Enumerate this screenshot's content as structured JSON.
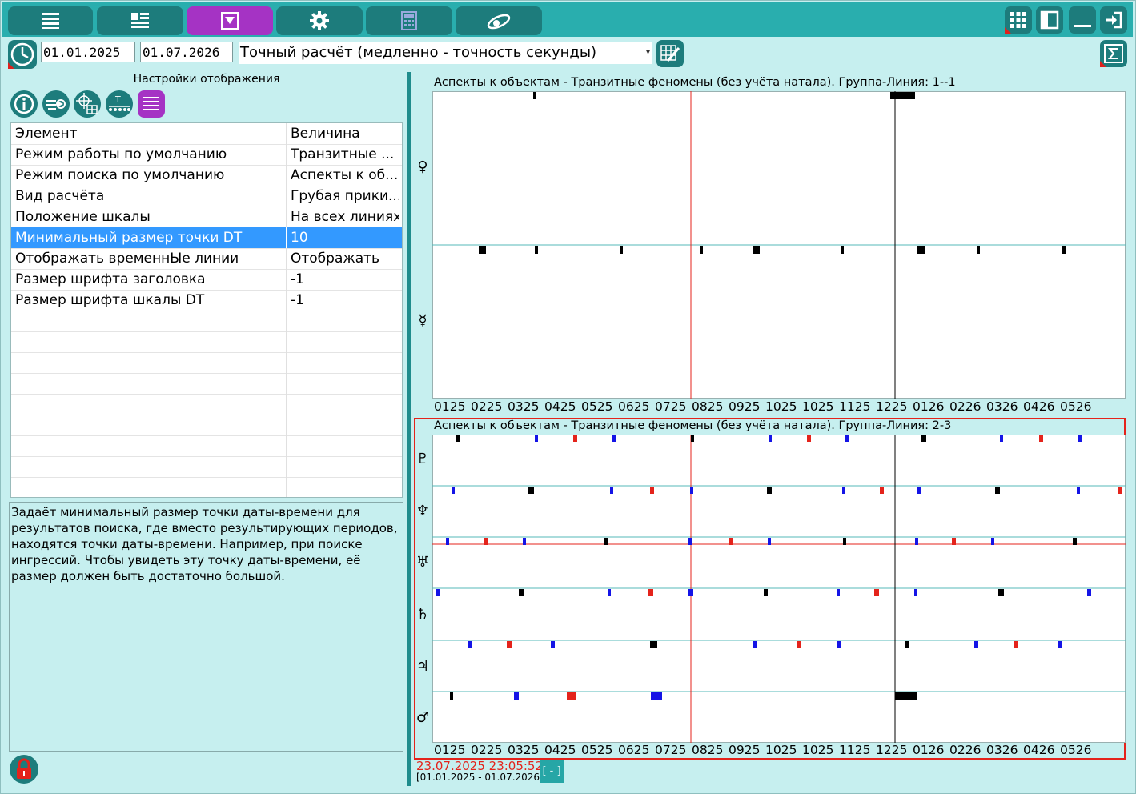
{
  "toolbar": {
    "buttons": [
      {
        "icon": "list-icon"
      },
      {
        "icon": "layout-icon"
      },
      {
        "icon": "filter-icon",
        "active": true
      },
      {
        "icon": "gear-icon"
      },
      {
        "icon": "calculator-icon"
      },
      {
        "icon": "orbit-icon"
      }
    ],
    "right_buttons": [
      {
        "icon": "grid-icon"
      },
      {
        "icon": "panel-icon"
      },
      {
        "icon": "minimize-icon"
      },
      {
        "icon": "exit-icon"
      }
    ]
  },
  "range": {
    "start_date": "01.01.2025",
    "end_date": "01.07.2026",
    "calc_mode": "Точный расчёт (медленно - точность секунды)"
  },
  "left_panel": {
    "title": "Настройки отображения",
    "tool_icons": [
      "info-icon",
      "transfer-icon",
      "crosshair-grid-icon",
      "timeline-icon",
      "dots-grid-icon"
    ],
    "grid": {
      "headers": [
        "Элемент",
        "Величина"
      ],
      "rows": [
        {
          "name": "Режим работы по умолчанию",
          "value": "Транзитные ..."
        },
        {
          "name": "Режим поиска по умолчанию",
          "value": "Аспекты к об..."
        },
        {
          "name": "Вид расчёта",
          "value": "Грубая прики..."
        },
        {
          "name": "Положение шкалы",
          "value": "На всех линиях"
        },
        {
          "name": "Минимальный размер точки DT",
          "value": "10"
        },
        {
          "name": "Отображать временнЫе линии",
          "value": "Отображать"
        },
        {
          "name": "Размер шрифта заголовка",
          "value": "-1"
        },
        {
          "name": "Размер шрифта шкалы DT",
          "value": "-1"
        }
      ],
      "selected_index": 4
    },
    "description": "Задаёт минимальный размер точки даты-времени для результатов поиска, где вместо результирующих периодов, находятся точки даты-времени. Например, при поиске ингрессий. Чтобы увидеть эту точку даты-времени, её размер должен быть достаточно большой."
  },
  "colors": {
    "accent": "#29aeae",
    "button": "#1d7c7c",
    "active": "#a533c4",
    "selection": "#3399ff",
    "marker_red": "#e4231b",
    "marker_blue": "#1414e6",
    "marker_black": "#000000"
  },
  "charts": [
    {
      "title": "Аспекты к объектам - Транзитные феномены (без учёта натала). Группа-Линия: 1--1",
      "rows": [
        "♀",
        "☿"
      ],
      "ticks": [
        "0125",
        "0225",
        "0325",
        "0425",
        "0525",
        "0625",
        "0725",
        "0825",
        "0925",
        "1025",
        "1025",
        "1125",
        "1225",
        "0126",
        "0226",
        "0326",
        "0426",
        "0526"
      ]
    },
    {
      "title": "Аспекты к объектам - Транзитные феномены (без учёта натала). Группа-Линия: 2-3",
      "rows": [
        "♇",
        "♆",
        "♅",
        "♄",
        "♃",
        "♂"
      ],
      "ticks": [
        "0125",
        "0225",
        "0325",
        "0425",
        "0525",
        "0625",
        "0725",
        "0825",
        "0925",
        "1025",
        "1025",
        "1125",
        "1225",
        "0126",
        "0226",
        "0326",
        "0426",
        "0526"
      ]
    }
  ],
  "status": {
    "current_datetime": "23.07.2025 23:05:52",
    "range_text": "[01.01.2025 - 01.07.2026]",
    "toggle_label": "[ - ]"
  }
}
